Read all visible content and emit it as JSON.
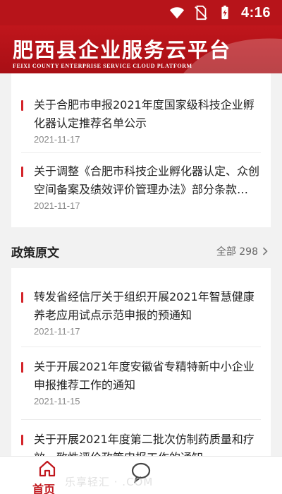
{
  "status": {
    "time": "4:16"
  },
  "header": {
    "title": "肥西县企业服务云平台",
    "subtitle": "FEIXI COUNTY ENTERPRISE SERVICE CLOUD PLATFORM"
  },
  "top_news": [
    {
      "title_line1": "关于合肥市申报2021年度国家级科技企业孵",
      "title_line2": "化器认定推荐名单公示",
      "date": "2021-11-17"
    },
    {
      "title_line1": "关于调整《合肥市科技企业孵化器认定、众创",
      "title_line2": "空间备案及绩效评价管理办法》部分条款的通知",
      "date": "2021-11-17"
    }
  ],
  "policy_section": {
    "title": "政策原文",
    "more_label": "全部 298",
    "items": [
      {
        "title_line1": "转发省经信厅关于组织开展2021年智慧健康",
        "title_line2": "养老应用试点示范申报的预通知",
        "date": "2021-11-17"
      },
      {
        "title_line1": "关于开展2021年度安徽省专精特新中小企业",
        "title_line2": "申报推荐工作的通知",
        "date": "2021-11-15"
      },
      {
        "title_line1": "关于开展2021年度第二批次仿制药质量和疗",
        "title_line2": "效一致性评价政策申报工作的通知",
        "date": ""
      }
    ]
  },
  "bottom_nav": {
    "home_label": "首页"
  },
  "watermark": "乐享轻汇 · .COM",
  "colors": {
    "brand_red": "#c0161c",
    "accent_bar": "#d4242a"
  },
  "icons": [
    "wifi-icon",
    "no-sim-icon",
    "battery-icon",
    "chevron-right-icon",
    "home-icon",
    "chat-icon"
  ]
}
